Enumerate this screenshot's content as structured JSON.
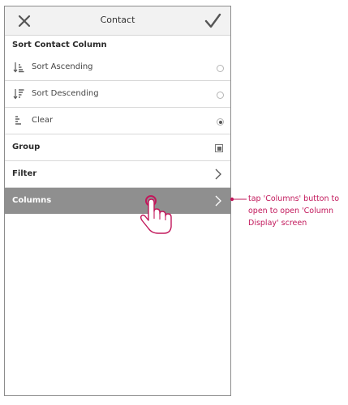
{
  "header": {
    "title": "Contact"
  },
  "sort_section": {
    "title": "Sort Contact Column",
    "options": [
      {
        "label": "Sort Ascending",
        "selected": false,
        "icon": "sort-ascending-icon"
      },
      {
        "label": "Sort Descending",
        "selected": false,
        "icon": "sort-descending-icon"
      },
      {
        "label": "Clear",
        "selected": true,
        "icon": "clear-sort-icon"
      }
    ]
  },
  "group": {
    "label": "Group",
    "checked": true
  },
  "filter": {
    "label": "Filter"
  },
  "columns": {
    "label": "Columns"
  },
  "annotation": {
    "text": "tap 'Columns' button to open to open 'Column Display' screen"
  },
  "colors": {
    "accent": "#c2185b",
    "highlight_row": "#8f8f8f"
  }
}
